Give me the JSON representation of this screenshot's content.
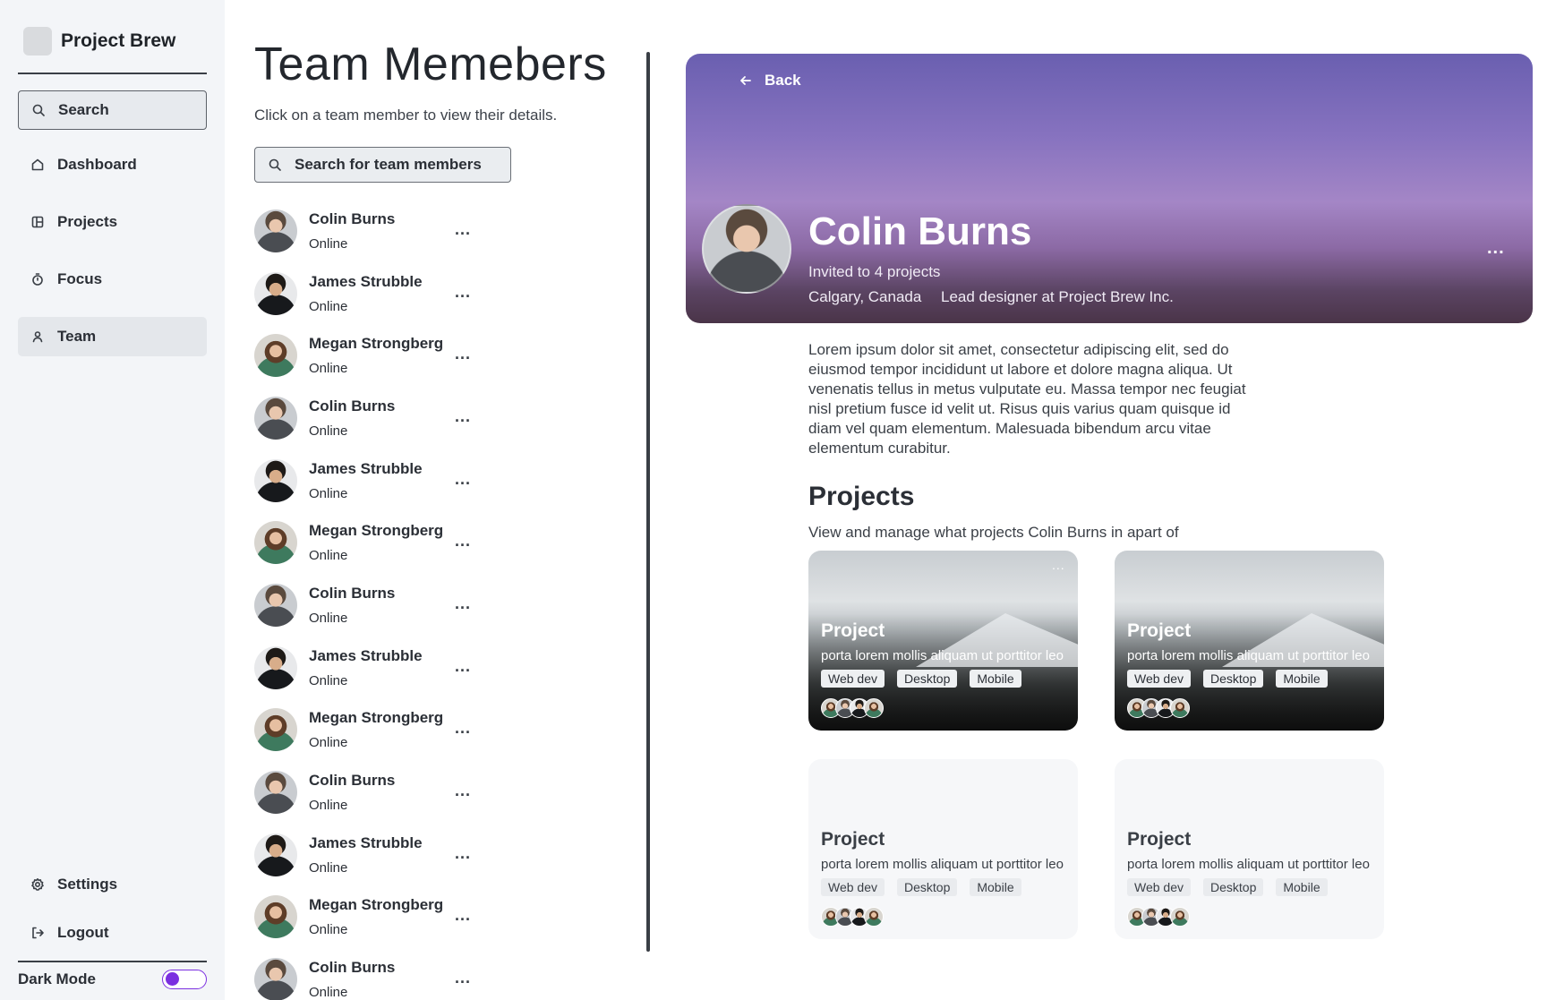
{
  "brand": {
    "name": "Project Brew"
  },
  "sidebar": {
    "search_label": "Search",
    "items": [
      {
        "label": "Dashboard",
        "icon": "home-icon"
      },
      {
        "label": "Projects",
        "icon": "layout-icon"
      },
      {
        "label": "Focus",
        "icon": "timer-icon"
      },
      {
        "label": "Team",
        "icon": "user-icon",
        "active": true
      }
    ],
    "bottom": [
      {
        "label": "Settings",
        "icon": "gear-icon"
      },
      {
        "label": "Logout",
        "icon": "logout-icon"
      }
    ],
    "dark_mode_label": "Dark Mode",
    "dark_mode_on": false
  },
  "team": {
    "title": "Team Memebers",
    "subtitle": "Click on a team member to view their details.",
    "search_placeholder": "Search for team members",
    "members": [
      {
        "name": "Colin Burns",
        "status": "Online"
      },
      {
        "name": "James Strubble",
        "status": "Online"
      },
      {
        "name": "Megan Strongberg",
        "status": "Online"
      },
      {
        "name": "Colin Burns",
        "status": "Online"
      },
      {
        "name": "James Strubble",
        "status": "Online"
      },
      {
        "name": "Megan Strongberg",
        "status": "Online"
      },
      {
        "name": "Colin Burns",
        "status": "Online"
      },
      {
        "name": "James Strubble",
        "status": "Online"
      },
      {
        "name": "Megan Strongberg",
        "status": "Online"
      },
      {
        "name": "Colin Burns",
        "status": "Online"
      },
      {
        "name": "James Strubble",
        "status": "Online"
      },
      {
        "name": "Megan Strongberg",
        "status": "Online"
      },
      {
        "name": "Colin Burns",
        "status": "Online"
      }
    ],
    "more_glyph": "..."
  },
  "profile": {
    "back_label": "Back",
    "name": "Colin Burns",
    "invited": "Invited to 4 projects",
    "location": "Calgary, Canada",
    "role": "Lead designer at Project Brew Inc.",
    "more_glyph": "...",
    "bio": "Lorem ipsum dolor sit amet, consectetur adipiscing elit, sed do eiusmod tempor incididunt ut labore et dolore magna aliqua. Ut venenatis tellus in metus vulputate eu. Massa tempor nec feugiat nisl pretium fusce id velit ut. Risus quis varius quam quisque id diam vel quam elementum. Malesuada bibendum arcu vitae elementum curabitur.",
    "projects_title": "Projects",
    "projects_subtitle": "View and manage what projects Colin Burns in apart of",
    "projects": [
      {
        "title": "Project",
        "desc": "porta lorem mollis aliquam ut porttitor leo",
        "tags": [
          "Web dev",
          "Desktop",
          "Mobile"
        ],
        "has_image": true
      },
      {
        "title": "Project",
        "desc": "porta lorem mollis aliquam ut porttitor leo",
        "tags": [
          "Web dev",
          "Desktop",
          "Mobile"
        ],
        "has_image": true
      },
      {
        "title": "Project",
        "desc": "porta lorem mollis aliquam ut porttitor leo",
        "tags": [
          "Web dev",
          "Desktop",
          "Mobile"
        ],
        "has_image": false
      },
      {
        "title": "Project",
        "desc": "porta lorem mollis aliquam ut porttitor leo",
        "tags": [
          "Web dev",
          "Desktop",
          "Mobile"
        ],
        "has_image": false
      }
    ]
  },
  "colors": {
    "accent": "#7b2fe0",
    "sidebar_bg": "#f3f5f8",
    "hero_top": "#6a5fb0",
    "hero_bottom": "#4a3448"
  }
}
